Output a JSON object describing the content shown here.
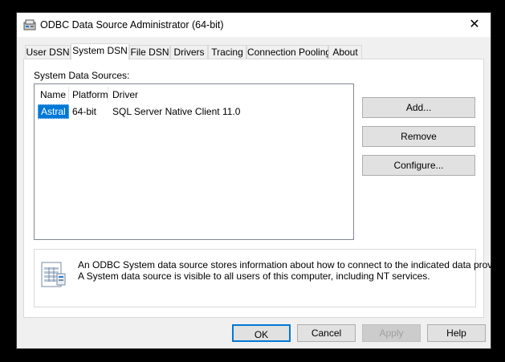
{
  "window": {
    "title": "ODBC Data Source Administrator (64-bit)",
    "close_glyph": "✕"
  },
  "tabs": [
    {
      "label": "User DSN"
    },
    {
      "label": "System DSN",
      "active": true
    },
    {
      "label": "File DSN"
    },
    {
      "label": "Drivers"
    },
    {
      "label": "Tracing"
    },
    {
      "label": "Connection Pooling"
    },
    {
      "label": "About"
    }
  ],
  "panel": {
    "section_label": "System Data Sources:",
    "columns": [
      "Name",
      "Platform",
      "Driver"
    ],
    "rows": [
      {
        "name": "Astral",
        "platform": "64-bit",
        "driver": "SQL Server Native Client 11.0",
        "selected": true
      }
    ],
    "buttons": {
      "add": "Add...",
      "remove": "Remove",
      "configure": "Configure..."
    },
    "info": {
      "icon": "data-source-icon",
      "line1": "An ODBC System data source stores information about how to connect to the indicated data provider.",
      "line2": "A System data source is visible to all users of this computer, including NT services."
    }
  },
  "footer": {
    "ok": "OK",
    "cancel": "Cancel",
    "apply": "Apply",
    "help": "Help"
  },
  "colors": {
    "accent": "#0078d7",
    "window_bg": "#f0f0f0",
    "panel_bg": "#ffffff"
  }
}
